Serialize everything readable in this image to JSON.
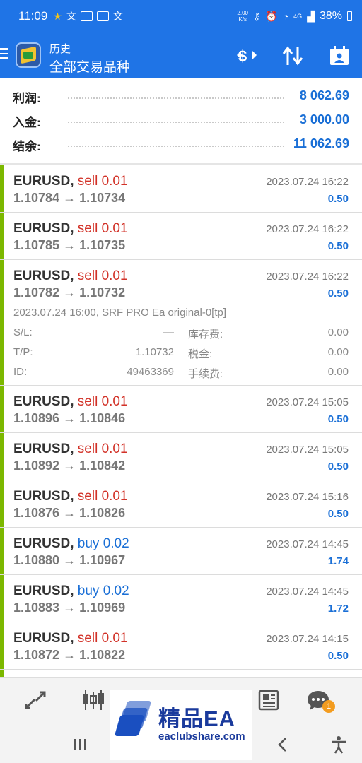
{
  "status": {
    "time": "11:09",
    "speed_top": "2.00",
    "speed_bottom": "K/s",
    "net": "4G",
    "battery": "38%"
  },
  "app": {
    "title": "历史",
    "subtitle": "全部交易品种",
    "icons": [
      "menu-icon",
      "app-logo",
      "currency-filter-icon",
      "sort-icon",
      "calendar-icon"
    ]
  },
  "summary": [
    {
      "label": "利润:",
      "value": "8 062.69"
    },
    {
      "label": "入金:",
      "value": "3 000.00"
    },
    {
      "label": "结余:",
      "value": "11 062.69"
    }
  ],
  "trades": [
    {
      "symbol": "EURUSD,",
      "side": "sell 0.01",
      "type": "sell",
      "prices": "1.10784 → 1.10734",
      "time": "2023.07.24 16:22",
      "profit": "0.50"
    },
    {
      "symbol": "EURUSD,",
      "side": "sell 0.01",
      "type": "sell",
      "prices": "1.10785 → 1.10735",
      "time": "2023.07.24 16:22",
      "profit": "0.50"
    },
    {
      "symbol": "EURUSD,",
      "side": "sell 0.01",
      "type": "sell",
      "prices": "1.10782 → 1.10732",
      "time": "2023.07.24 16:22",
      "profit": "0.50"
    },
    {
      "symbol": "EURUSD,",
      "side": "sell 0.01",
      "type": "sell",
      "prices": "1.10896 → 1.10846",
      "time": "2023.07.24 15:05",
      "profit": "0.50"
    },
    {
      "symbol": "EURUSD,",
      "side": "sell 0.01",
      "type": "sell",
      "prices": "1.10892 → 1.10842",
      "time": "2023.07.24 15:05",
      "profit": "0.50"
    },
    {
      "symbol": "EURUSD,",
      "side": "sell 0.01",
      "type": "sell",
      "prices": "1.10876 → 1.10826",
      "time": "2023.07.24 15:16",
      "profit": "0.50"
    },
    {
      "symbol": "EURUSD,",
      "side": "buy 0.02",
      "type": "buy",
      "prices": "1.10880 → 1.10967",
      "time": "2023.07.24 14:45",
      "profit": "1.74"
    },
    {
      "symbol": "EURUSD,",
      "side": "buy 0.02",
      "type": "buy",
      "prices": "1.10883 → 1.10969",
      "time": "2023.07.24 14:45",
      "profit": "1.72"
    },
    {
      "symbol": "EURUSD,",
      "side": "sell 0.01",
      "type": "sell",
      "prices": "1.10872 → 1.10822",
      "time": "2023.07.24 14:15",
      "profit": "0.50"
    }
  ],
  "detail": {
    "comment": "2023.07.24 16:00, SRF PRO Ea original-0[tp]",
    "rows": [
      {
        "l1": "S/L:",
        "v1": "—",
        "l2": "库存费:",
        "v2": "0.00"
      },
      {
        "l1": "T/P:",
        "v1": "1.10732",
        "l2": "税金:",
        "v2": "0.00"
      },
      {
        "l1": "ID:",
        "v1": "49463369",
        "l2": "手续费:",
        "v2": "0.00"
      }
    ]
  },
  "bottom_nav": {
    "icons": [
      "trade-icon",
      "chart-icon",
      "news-icon",
      "chat-icon"
    ],
    "badge": "1",
    "system": [
      "recent-apps-icon",
      "back-icon",
      "accessibility-icon"
    ]
  },
  "watermark": {
    "cn": "精品EA",
    "en": "eaclubshare.com"
  },
  "colors": {
    "primary": "#1f74e6",
    "profit": "#1a6fd6",
    "sell": "#d23228",
    "bar": "#7cb800",
    "badge": "#f39c1f"
  }
}
